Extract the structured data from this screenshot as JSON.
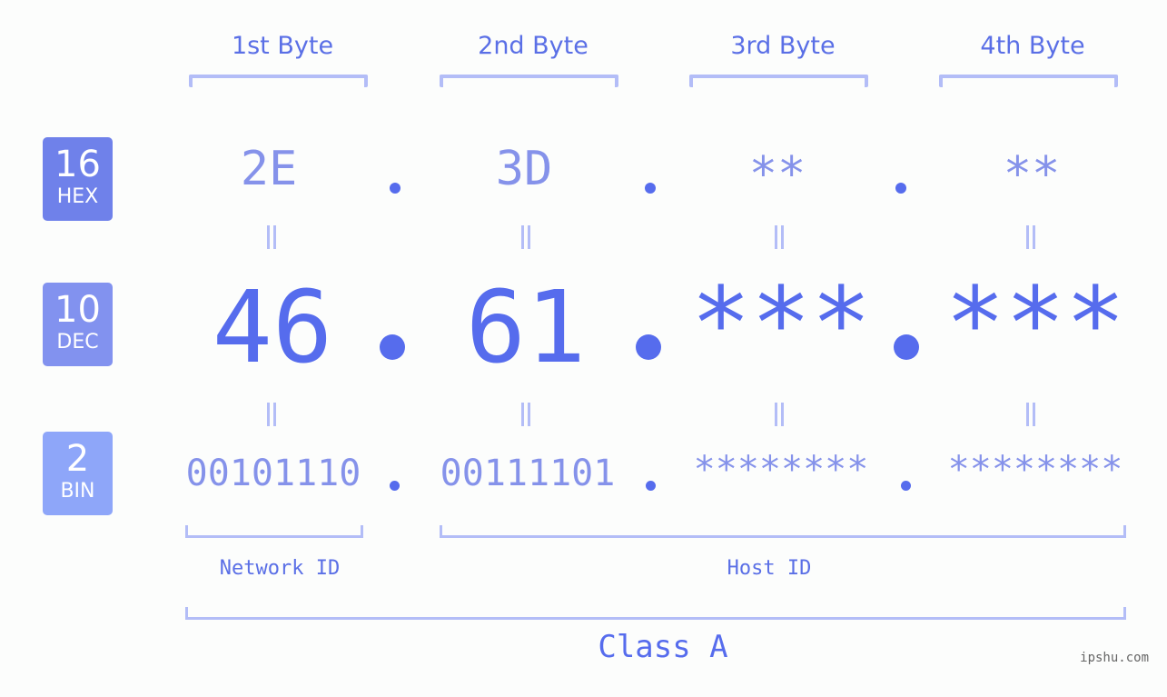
{
  "colors": {
    "hex_badge": "#6f81ea",
    "dec_badge": "#8292ef",
    "bin_badge": "#8ea6f9",
    "accent": "#566ced",
    "muted": "#8592ea",
    "bracket": "#b3bdf7"
  },
  "bases": [
    {
      "number": "16",
      "label": "HEX"
    },
    {
      "number": "10",
      "label": "DEC"
    },
    {
      "number": "2",
      "label": "BIN"
    }
  ],
  "bytes": [
    {
      "label": "1st Byte",
      "hex": "2E",
      "dec": "46",
      "bin": "00101110"
    },
    {
      "label": "2nd Byte",
      "hex": "3D",
      "dec": "61",
      "bin": "00111101"
    },
    {
      "label": "3rd Byte",
      "hex": "**",
      "dec": "***",
      "bin": "********"
    },
    {
      "label": "4th Byte",
      "hex": "**",
      "dec": "***",
      "bin": "********"
    }
  ],
  "segments": {
    "network": "Network ID",
    "host": "Host ID",
    "class": "Class A"
  },
  "watermark": "ipshu.com"
}
